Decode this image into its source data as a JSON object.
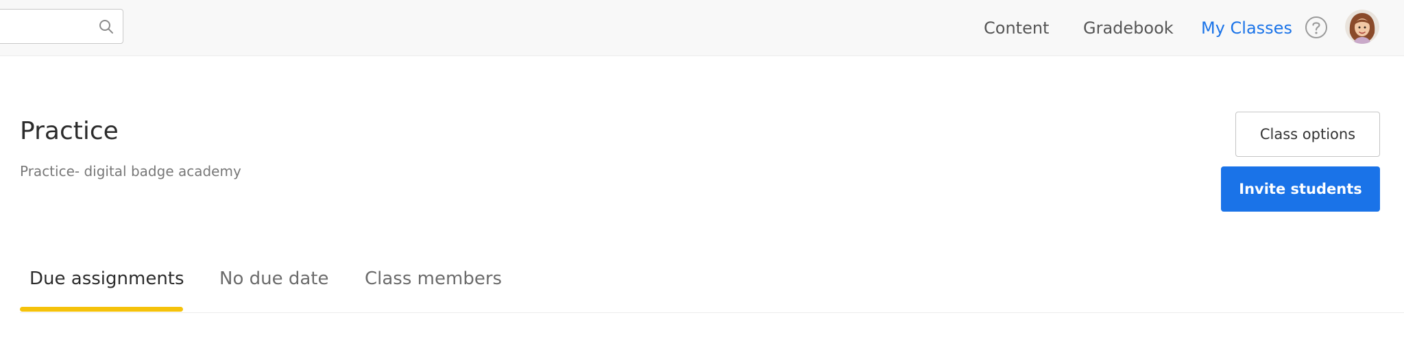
{
  "nav": {
    "items": [
      {
        "label": "Content"
      },
      {
        "label": "Gradebook"
      },
      {
        "label": "My Classes",
        "active": true
      }
    ]
  },
  "icons": {
    "search": "search-icon",
    "help": "help-icon",
    "avatar": "avatar"
  },
  "colors": {
    "accent": "#1a73e8",
    "tab_indicator": "#f5c20b",
    "topbar_bg": "#f8f8f8"
  },
  "page": {
    "title": "Practice",
    "subtitle": "Practice- digital badge academy"
  },
  "actions": {
    "class_options": "Class options",
    "invite_students": "Invite students"
  },
  "tabs": [
    {
      "label": "Due assignments",
      "active": true
    },
    {
      "label": "No due date"
    },
    {
      "label": "Class members"
    }
  ]
}
